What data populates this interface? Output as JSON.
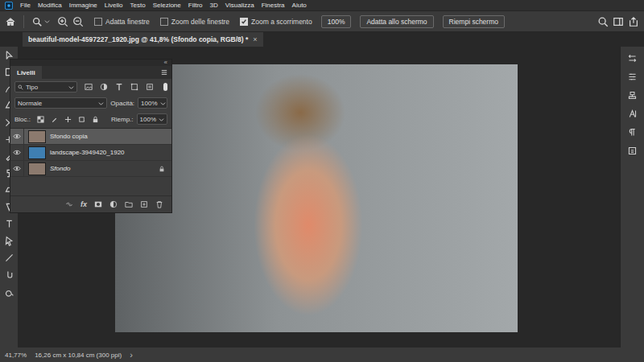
{
  "menu_bar": {
    "items": [
      "File",
      "Modifica",
      "Immagine",
      "Livello",
      "Testo",
      "Selezione",
      "Filtro",
      "3D",
      "Visualizza",
      "Finestra",
      "Aiuto"
    ]
  },
  "options_bar": {
    "checkboxes": [
      {
        "label": "Adatta finestre",
        "checked": false
      },
      {
        "label": "Zoom delle finestre",
        "checked": false
      },
      {
        "label": "Zoom a scorrimento",
        "checked": true
      }
    ],
    "buttons": [
      "100%",
      "Adatta allo schermo",
      "Riempi schermo"
    ]
  },
  "document_tab": {
    "title": "beautiful-model-4597227_1920.jpg @ 41,8% (Sfondo copia, RGB/8) *",
    "close": "×"
  },
  "layers_panel": {
    "collapse": "«",
    "title": "Livelli",
    "filter": "Tipo",
    "blend_mode": "Normale",
    "opacity_label": "Opacità:",
    "opacity": "100%",
    "lock_label": "Bloc.:",
    "fill_label": "Riemp.:",
    "fill": "100%",
    "fx_label": "fx",
    "layers": [
      {
        "name": "Sfondo copia",
        "selected": true,
        "visible": true,
        "locked": false,
        "background": false,
        "color": "#8c7a6e"
      },
      {
        "name": "landscape-3949420_1920",
        "selected": false,
        "visible": true,
        "locked": false,
        "background": false,
        "color": "#3f7fb2"
      },
      {
        "name": "Sfondo",
        "selected": false,
        "visible": true,
        "locked": true,
        "background": true,
        "color": "#8c7a6e"
      }
    ]
  },
  "status_bar": {
    "zoom": "41,77%",
    "info": "16,26 cm x 10,84 cm (300 ppi)",
    "more": "›"
  }
}
